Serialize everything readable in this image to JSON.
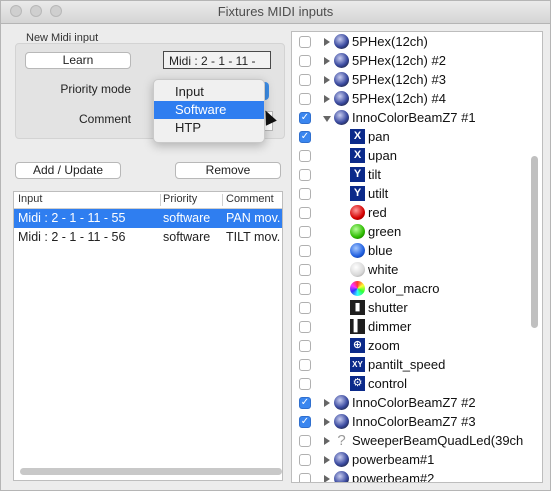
{
  "window": {
    "title": "Fixtures MIDI inputs"
  },
  "new_midi": {
    "group_title": "New Midi input",
    "learn_label": "Learn",
    "midi_value": "Midi : 2 - 1 - 11 -",
    "priority_label": "Priority mode",
    "comment_label": "Comment",
    "priority_options": [
      "Input",
      "Software",
      "HTP"
    ],
    "priority_selected": "Software"
  },
  "actions": {
    "add_label": "Add / Update",
    "remove_label": "Remove"
  },
  "table": {
    "columns": [
      "Input",
      "Priority",
      "Comment"
    ],
    "rows": [
      {
        "input": "Midi : 2 - 1 - 11 - 55",
        "priority": "software",
        "comment": "PAN mov."
      },
      {
        "input": "Midi : 2 - 1 - 11 - 56",
        "priority": "software",
        "comment": "TILT mov."
      }
    ]
  },
  "tree": {
    "items": [
      {
        "label": "5PHex(12ch)",
        "checked": false,
        "level": 0,
        "expand": "closed",
        "icon": "fixture-icon"
      },
      {
        "label": "5PHex(12ch) #2",
        "checked": false,
        "level": 0,
        "expand": "closed",
        "icon": "fixture-icon"
      },
      {
        "label": "5PHex(12ch) #3",
        "checked": false,
        "level": 0,
        "expand": "closed",
        "icon": "fixture-icon"
      },
      {
        "label": "5PHex(12ch) #4",
        "checked": false,
        "level": 0,
        "expand": "closed",
        "icon": "fixture-icon"
      },
      {
        "label": "InnoColorBeamZ7 #1",
        "checked": true,
        "level": 0,
        "expand": "open",
        "icon": "fixture-icon"
      },
      {
        "label": "pan",
        "checked": true,
        "level": 1,
        "icon": "pan-icon"
      },
      {
        "label": "upan",
        "checked": false,
        "level": 1,
        "icon": "upan-icon"
      },
      {
        "label": "tilt",
        "checked": false,
        "level": 1,
        "icon": "tilt-icon"
      },
      {
        "label": "utilt",
        "checked": false,
        "level": 1,
        "icon": "utilt-icon"
      },
      {
        "label": "red",
        "checked": false,
        "level": 1,
        "icon": "red-icon"
      },
      {
        "label": "green",
        "checked": false,
        "level": 1,
        "icon": "green-icon"
      },
      {
        "label": "blue",
        "checked": false,
        "level": 1,
        "icon": "blue-icon"
      },
      {
        "label": "white",
        "checked": false,
        "level": 1,
        "icon": "white-icon"
      },
      {
        "label": "color_macro",
        "checked": false,
        "level": 1,
        "icon": "color-macro-icon"
      },
      {
        "label": "shutter",
        "checked": false,
        "level": 1,
        "icon": "shutter-icon"
      },
      {
        "label": "dimmer",
        "checked": false,
        "level": 1,
        "icon": "dimmer-icon"
      },
      {
        "label": "zoom",
        "checked": false,
        "level": 1,
        "icon": "zoom-icon"
      },
      {
        "label": "pantilt_speed",
        "checked": false,
        "level": 1,
        "icon": "pantilt-speed-icon"
      },
      {
        "label": "control",
        "checked": false,
        "level": 1,
        "icon": "control-icon"
      },
      {
        "label": "InnoColorBeamZ7 #2",
        "checked": true,
        "level": 0,
        "expand": "closed",
        "icon": "fixture-icon"
      },
      {
        "label": "InnoColorBeamZ7 #3",
        "checked": true,
        "level": 0,
        "expand": "closed",
        "icon": "fixture-icon"
      },
      {
        "label": "SweeperBeamQuadLed(39ch",
        "checked": false,
        "level": 0,
        "expand": "closed",
        "icon": "question-icon"
      },
      {
        "label": "powerbeam#1",
        "checked": false,
        "level": 0,
        "expand": "closed",
        "icon": "fixture-icon"
      },
      {
        "label": "powerbeam#2",
        "checked": false,
        "level": 0,
        "expand": "closed",
        "icon": "fixture-icon"
      }
    ]
  }
}
